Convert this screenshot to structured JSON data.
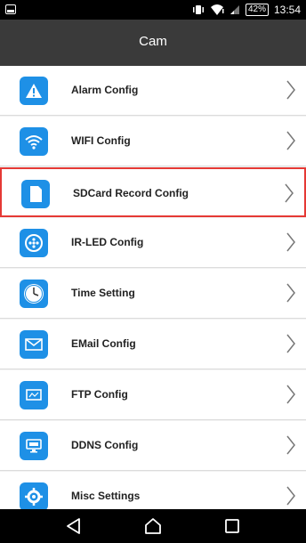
{
  "status_bar": {
    "battery": "42%",
    "time": "13:54",
    "icons": [
      "notification-icon",
      "vibrate-icon",
      "wifi-icon",
      "signal-icon",
      "battery-icon"
    ]
  },
  "app_bar": {
    "title": "Cam"
  },
  "menu": {
    "items": [
      {
        "label": "Alarm Config",
        "icon": "alarm-icon"
      },
      {
        "label": "WIFI Config",
        "icon": "wifi-icon"
      },
      {
        "label": "SDCard Record Config",
        "icon": "sdcard-icon",
        "selected": true
      },
      {
        "label": "IR-LED Config",
        "icon": "ir-led-icon"
      },
      {
        "label": "Time Setting",
        "icon": "clock-icon"
      },
      {
        "label": "EMail Config",
        "icon": "email-icon"
      },
      {
        "label": "FTP Config",
        "icon": "ftp-icon"
      },
      {
        "label": "DDNS Config",
        "icon": "ddns-icon"
      },
      {
        "label": "Misc Settings",
        "icon": "gear-icon"
      }
    ]
  },
  "nav_bar": {
    "buttons": [
      "back-icon",
      "home-icon",
      "recents-icon"
    ]
  },
  "colors": {
    "accent": "#1e90e6",
    "selected_border": "#e53935",
    "appbar": "#3a3a3a"
  }
}
